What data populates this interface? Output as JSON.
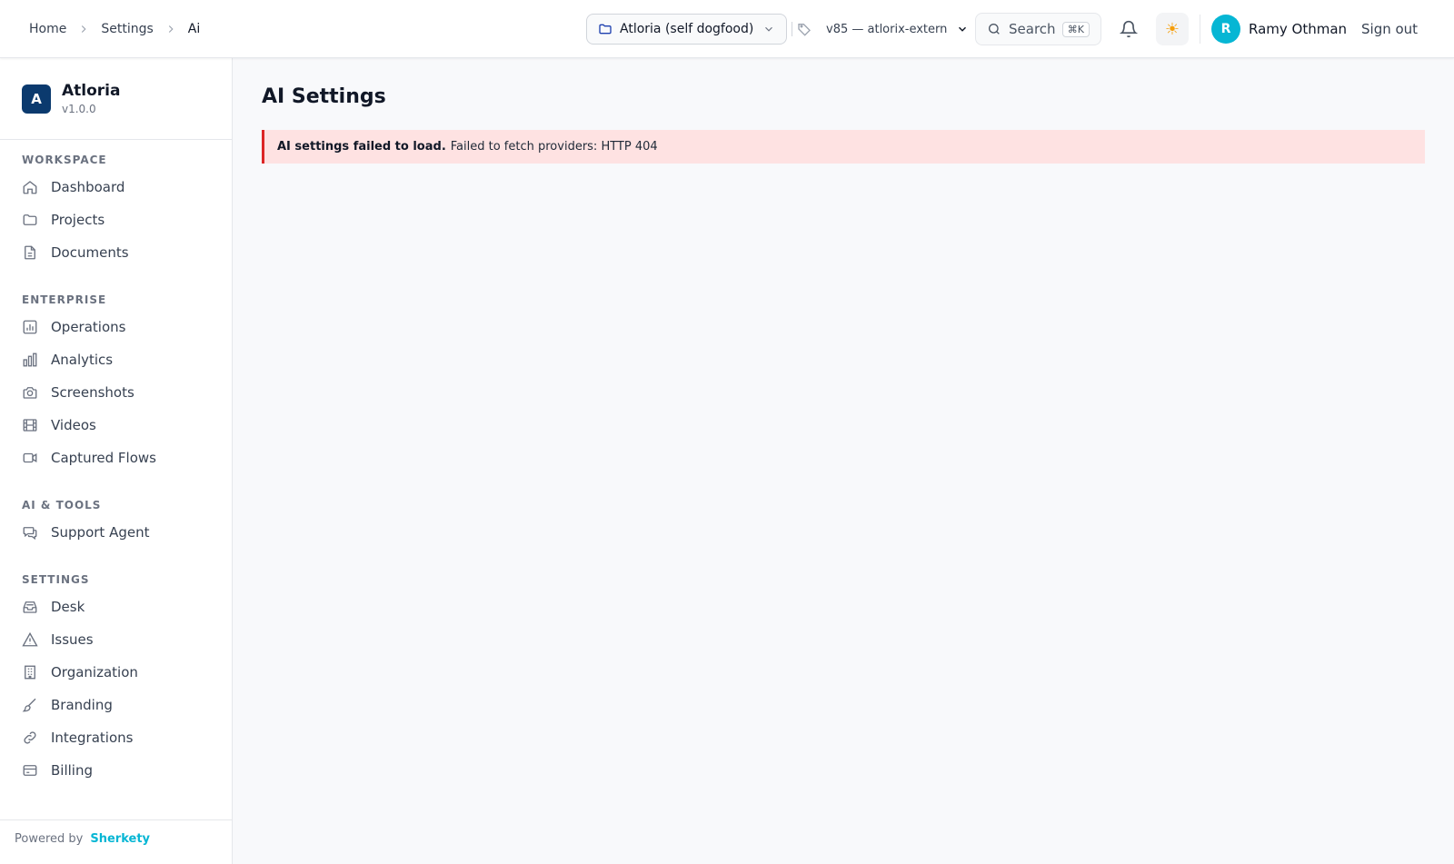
{
  "breadcrumb": [
    "Home",
    "Settings",
    "Ai"
  ],
  "header": {
    "project_selector": "Atloria (self dogfood)",
    "version_selector": "v85 — atlorix-extern",
    "search_label": "Search",
    "search_shortcut": "⌘K",
    "theme_icon": "sun-icon",
    "user_initial": "R",
    "user_name": "Ramy Othman",
    "sign_out": "Sign out"
  },
  "sidebar": {
    "brand_initial": "A",
    "brand_name": "Atloria",
    "brand_version": "v1.0.0",
    "sections": [
      {
        "label": "WORKSPACE",
        "items": [
          "Dashboard",
          "Projects",
          "Documents"
        ]
      },
      {
        "label": "ENTERPRISE",
        "items": [
          "Operations",
          "Analytics",
          "Screenshots",
          "Videos",
          "Captured Flows"
        ]
      },
      {
        "label": "AI & TOOLS",
        "items": [
          "Support Agent"
        ]
      },
      {
        "label": "SETTINGS",
        "items": [
          "Desk",
          "Issues",
          "Organization",
          "Branding",
          "Integrations",
          "Billing"
        ]
      }
    ],
    "footer_prefix": "Powered by",
    "footer_brand": "Sherkety"
  },
  "main": {
    "title": "AI Settings",
    "alert_title": "AI settings failed to load.",
    "alert_message": "Failed to fetch providers: HTTP 404"
  },
  "colors": {
    "accent": "#06b6d4",
    "brand": "#0b3a6e",
    "alert_bg": "#fee2e2",
    "alert_border": "#dc2626"
  }
}
